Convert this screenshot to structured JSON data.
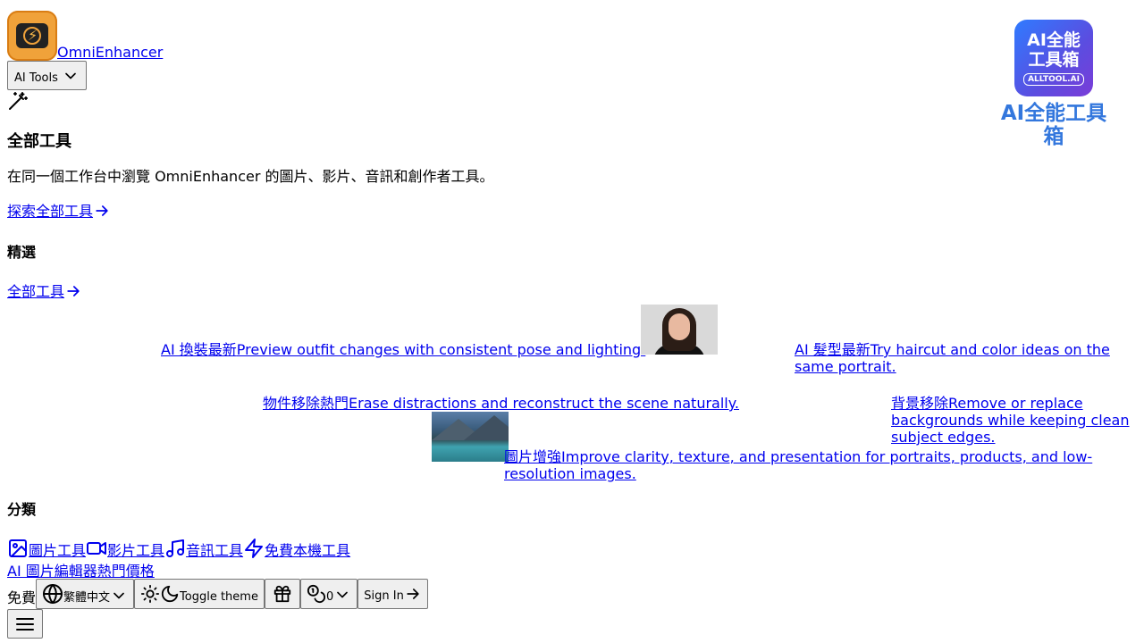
{
  "brand": {
    "name": "OmniEnhancer"
  },
  "nav": {
    "ai_tools_label": "AI Tools"
  },
  "hero": {
    "title": "全部工具",
    "description": "在同一個工作台中瀏覽 OmniEnhancer 的圖片、影片、音訊和創作者工具。",
    "explore_link": "探索全部工具"
  },
  "featured": {
    "heading": "精選",
    "all_tools_link": "全部工具",
    "items": [
      {
        "name": "AI 換裝",
        "badge": "最新",
        "desc": "Preview outfit changes with consistent pose and lighting."
      },
      {
        "name": "AI 髮型",
        "badge": "最新",
        "desc": "Try haircut and color ideas on the same portrait."
      },
      {
        "name": "物件移除",
        "badge": "熱門",
        "desc": "Erase distractions and reconstruct the scene naturally."
      },
      {
        "name": "背景移除",
        "badge": "",
        "desc": "Remove or replace backgrounds while keeping clean subject edges."
      },
      {
        "name": "圖片增強",
        "badge": "",
        "desc": "Improve clarity, texture, and presentation for portraits, products, and low-resolution images."
      }
    ]
  },
  "categories": {
    "heading": "分類",
    "items": [
      {
        "label": "圖片工具",
        "icon": "image-icon"
      },
      {
        "label": "影片工具",
        "icon": "video-icon"
      },
      {
        "label": "音訊工具",
        "icon": "music-icon"
      },
      {
        "label": "免費本機工具",
        "icon": "zap-icon"
      }
    ]
  },
  "footer_nav": {
    "editor_link": "AI 圖片編輯器",
    "hot_label": "熱門",
    "pricing_link": "價格",
    "free_label": "免費"
  },
  "controls": {
    "language": "繁體中文",
    "toggle_theme": "Toggle theme",
    "credits": "0",
    "sign_in": "Sign In"
  },
  "alltool_badge": {
    "line1": "AI全能",
    "line2": "工具箱",
    "line3": "ALLTOOL.AI",
    "caption": "AI全能工具箱"
  }
}
